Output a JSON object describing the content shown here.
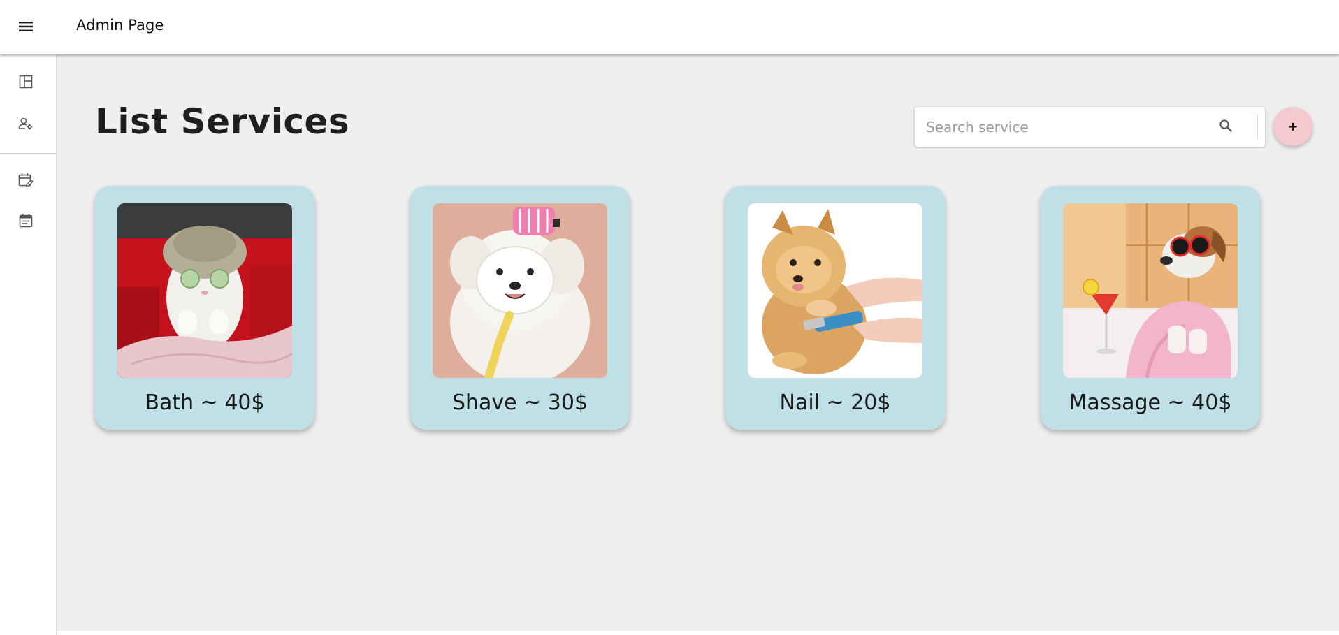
{
  "header": {
    "title": "Admin Page",
    "menu_icon": "menu-icon"
  },
  "sidebar": {
    "items": [
      {
        "name": "dashboard",
        "icon": "dashboard-icon"
      },
      {
        "name": "manage-users",
        "icon": "user-settings-icon"
      },
      {
        "name": "edit-schedule",
        "icon": "calendar-edit-icon"
      },
      {
        "name": "appointments",
        "icon": "calendar-icon"
      }
    ]
  },
  "main": {
    "title": "List Services",
    "search": {
      "placeholder": "Search service",
      "value": "",
      "icon": "search-icon"
    },
    "add_button_label": "+",
    "services": [
      {
        "label": "Bath ~ 40$",
        "image": "cat-with-towel-and-cucumber-eye-mask"
      },
      {
        "label": "Shave ~ 30$",
        "image": "white-dog-with-face-mask-and-hair-roller"
      },
      {
        "label": "Nail ~ 20$",
        "image": "pomeranian-getting-nails-trimmed"
      },
      {
        "label": "Massage ~ 40$",
        "image": "dog-in-pink-bathrobe-with-sunglasses"
      }
    ]
  },
  "colors": {
    "card_background": "#bfe0e6",
    "add_button": "#f4c9cf",
    "page_background": "#efefef"
  }
}
